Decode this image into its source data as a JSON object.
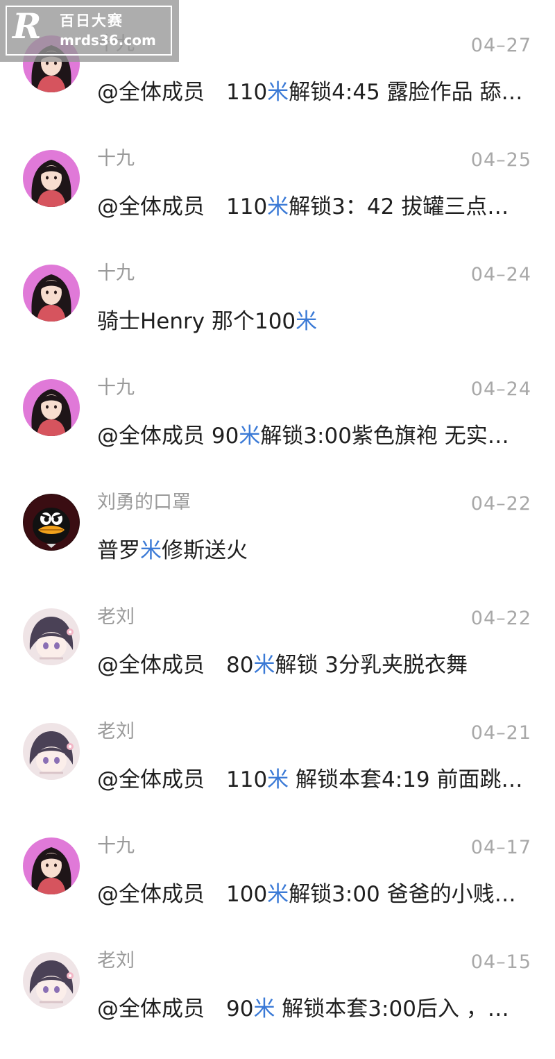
{
  "watermark": {
    "logo": "R",
    "title": "百日大赛",
    "url": "mrds36.com"
  },
  "messages": [
    {
      "sender": "十九",
      "avatar": "girl-qipao-avatar",
      "date": "04–27",
      "parts": [
        "@全体成员　110",
        "米",
        "解锁4:45 露脸作品 舔…"
      ]
    },
    {
      "sender": "十九",
      "avatar": "girl-qipao-avatar",
      "date": "04–25",
      "parts": [
        "@全体成员　110",
        "米",
        "解锁3：42 拔罐三点…"
      ]
    },
    {
      "sender": "十九",
      "avatar": "girl-qipao-avatar",
      "date": "04–24",
      "parts": [
        "骑士Henry 那个100",
        "米",
        ""
      ]
    },
    {
      "sender": "十九",
      "avatar": "girl-qipao-avatar",
      "date": "04–24",
      "parts": [
        "@全体成员 90",
        "米",
        "解锁3:00紫色旗袍 无实…"
      ]
    },
    {
      "sender": "刘勇的口罩",
      "avatar": "duck-avatar",
      "date": "04–22",
      "parts": [
        "普罗",
        "米",
        "修斯送火"
      ]
    },
    {
      "sender": "老刘",
      "avatar": "anime-girl-avatar",
      "date": "04–22",
      "parts": [
        "@全体成员　80",
        "米",
        "解锁 3分乳夹脱衣舞"
      ]
    },
    {
      "sender": "老刘",
      "avatar": "anime-girl-avatar",
      "date": "04–21",
      "parts": [
        "@全体成员　110",
        "米",
        " 解锁本套4:19 前面跳…"
      ]
    },
    {
      "sender": "十九",
      "avatar": "girl-qipao-avatar",
      "date": "04–17",
      "parts": [
        "@全体成员　100",
        "米",
        "解锁3:00 爸爸的小贱…"
      ]
    },
    {
      "sender": "老刘",
      "avatar": "anime-girl-avatar",
      "date": "04–15",
      "parts": [
        "@全体成员　90",
        "米",
        " 解锁本套3:00后入 ，…"
      ]
    }
  ],
  "colors": {
    "keyword": "#3b7ad6",
    "sender": "#9a9a9a",
    "date": "#a8a8a8",
    "message": "#1f1f1f"
  }
}
